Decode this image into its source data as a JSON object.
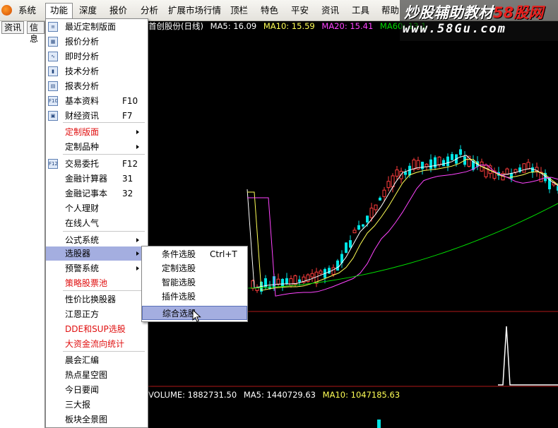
{
  "menubar": {
    "items": [
      "系统",
      "功能",
      "深度",
      "报价",
      "分析",
      "扩展市场行情",
      "顶栏",
      "特色",
      "平安",
      "资讯",
      "工具",
      "帮助"
    ],
    "active_index": 1
  },
  "watermark": {
    "line1_prefix": "炒股辅助教材",
    "line1_brand": "58股网",
    "line2": "www.58Gu.com"
  },
  "left_panel": {
    "tabs": [
      "资讯",
      "信息"
    ]
  },
  "chart": {
    "info": {
      "title": "首创股份(日线)",
      "ma5": "MA5: 16.09",
      "ma10": "MA10: 15.59",
      "ma20": "MA20: 15.41",
      "ma60": "MA60: 13.1"
    },
    "volume": {
      "label": "VOLUME: 1882731.50",
      "ma5": "MA5: 1440729.63",
      "ma10": "MA10: 1047185.63"
    },
    "colors": {
      "up": "#ff3c3c",
      "down": "#00e5e5",
      "ma5": "#ffffff",
      "ma10": "#ffff55",
      "ma20": "#ff44ff",
      "ma60": "#00dd00"
    }
  },
  "dropdown": {
    "items": [
      {
        "label": "最近定制版面",
        "icon": "doc-icon"
      },
      {
        "label": "报价分析",
        "icon": "table-icon"
      },
      {
        "label": "即时分析",
        "icon": "line-chart-icon"
      },
      {
        "label": "技术分析",
        "icon": "candlestick-icon"
      },
      {
        "label": "报表分析",
        "icon": "report-icon"
      },
      {
        "label": "基本资料",
        "shortcut": "F10",
        "icon": "f10-icon"
      },
      {
        "label": "财经资讯",
        "shortcut": "F7",
        "icon": "news-icon"
      },
      {
        "label": "定制版面",
        "red": true,
        "submenu": true
      },
      {
        "label": "定制品种",
        "submenu": true
      },
      {
        "label": "交易委托",
        "shortcut": "F12",
        "icon": "f12-icon"
      },
      {
        "label": "金融计算器",
        "shortcut": "31"
      },
      {
        "label": "金融记事本",
        "shortcut": "32"
      },
      {
        "label": "个人理财"
      },
      {
        "label": "在线人气"
      },
      {
        "label": "公式系统",
        "submenu": true
      },
      {
        "label": "选股器",
        "submenu": true,
        "highlighted": true
      },
      {
        "label": "预警系统",
        "submenu": true
      },
      {
        "label": "策略股票池",
        "red": true
      },
      {
        "label": "性价比换股器"
      },
      {
        "label": "江恩正方"
      },
      {
        "label": "DDE和SUP选股",
        "red": true
      },
      {
        "label": "大资金流向统计",
        "red": true
      },
      {
        "label": "晨会汇编"
      },
      {
        "label": "热点星空图"
      },
      {
        "label": "今日要闻"
      },
      {
        "label": "三大报"
      },
      {
        "label": "板块全景图"
      }
    ]
  },
  "submenu": {
    "items": [
      {
        "label": "条件选股",
        "shortcut": "Ctrl+T"
      },
      {
        "label": "定制选股"
      },
      {
        "label": "智能选股"
      },
      {
        "label": "插件选股"
      },
      {
        "label": "综合选股",
        "highlighted": true
      }
    ]
  }
}
